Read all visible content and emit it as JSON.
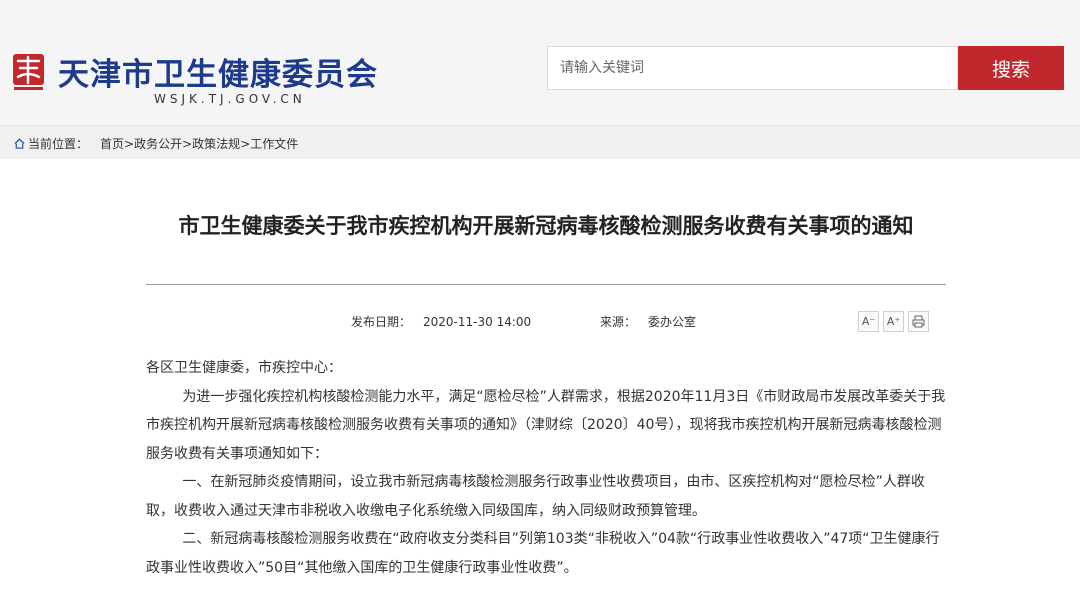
{
  "header": {
    "emblem_text": "天津",
    "site_title": "天津市卫生健康委员会",
    "site_domain": "WSJK.TJ.GOV.CN",
    "search_placeholder": "请输入关键词",
    "search_button": "搜索"
  },
  "breadcrumb": {
    "label": "当前位置：",
    "items": [
      "首页",
      "政务公开",
      "政策法规",
      "工作文件"
    ],
    "separator": ">"
  },
  "article": {
    "title": "市卫生健康委关于我市疾控机构开展新冠病毒核酸检测服务收费有关事项的通知",
    "date_label": "发布日期：",
    "date": "2020-11-30 14:00",
    "source_label": "来源：",
    "source": "委办公室",
    "tools": {
      "decrease_font": "A⁻",
      "increase_font": "A⁺",
      "print_icon": "print-icon"
    },
    "paragraphs": [
      "各区卫生健康委，市疾控中心：",
      "为进一步强化疾控机构核酸检测能力水平，满足“愿检尽检”人群需求，根据2020年11月3日《市财政局市发展改革委关于我市疾控机构开展新冠病毒核酸检测服务收费有关事项的通知》（津财综〔2020〕40号），现将我市疾控机构开展新冠病毒核酸检测服务收费有关事项通知如下：",
      "一、在新冠肺炎疫情期间，设立我市新冠病毒核酸检测服务行政事业性收费项目，由市、区疾控机构对“愿检尽检”人群收取，收费收入通过天津市非税收入收缴电子化系统缴入同级国库，纳入同级财政预算管理。",
      "二、新冠病毒核酸检测服务收费在“政府收支分类科目”列第103类“非税收入”04款“行政事业性收费收入”47项“卫生健康行政事业性收费收入”50目“其他缴入国库的卫生健康行政事业性收费”。"
    ]
  },
  "colors": {
    "brand_blue": "#1e3a8a",
    "search_red": "#c1272d",
    "emblem_red": "#c1272d"
  }
}
